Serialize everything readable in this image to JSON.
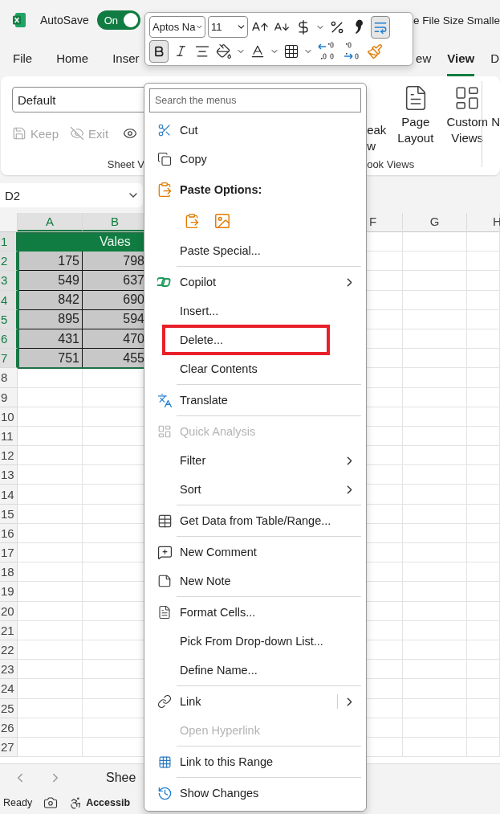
{
  "title_bar": {
    "autosave_label": "AutoSave",
    "autosave_toggle": {
      "label": "On",
      "on": true
    },
    "title": "e File Size Smalle"
  },
  "ribbon_tabs": [
    {
      "label": "File",
      "selected": false
    },
    {
      "label": "Home",
      "selected": false
    },
    {
      "label": "Inser",
      "selected": false
    },
    {
      "label": "ew",
      "selected": false
    },
    {
      "label": "View",
      "selected": true
    },
    {
      "label": "D",
      "selected": false
    }
  ],
  "ribbon": {
    "sheet_view_field": "Default",
    "sheet_view_buttons": [
      {
        "label": "Keep",
        "disabled": true
      },
      {
        "label": "Exit",
        "disabled": true
      }
    ],
    "sheet_view_group": "Sheet V",
    "workbook_fragment": [
      "eak",
      "w"
    ],
    "workbook_buttons": [
      {
        "lines": [
          "Page",
          "Layout"
        ]
      },
      {
        "lines": [
          "Custom",
          "Views"
        ]
      }
    ],
    "workbook_group": "ook Views",
    "next_fragment": "N"
  },
  "name_box": "D2",
  "columns_left": [
    {
      "label": "A",
      "selected": true
    },
    {
      "label": "B",
      "selected": true
    }
  ],
  "columns_right": [
    {
      "label": "F",
      "selected": false
    },
    {
      "label": "G",
      "selected": false
    },
    {
      "label": "H",
      "selected": false
    }
  ],
  "rows": [
    {
      "header": "1",
      "selected": true,
      "kind": "title",
      "title": "Vales"
    },
    {
      "header": "2",
      "selected": true,
      "kind": "values",
      "cells": [
        "175",
        "798"
      ]
    },
    {
      "header": "3",
      "selected": true,
      "kind": "values",
      "cells": [
        "549",
        "637"
      ]
    },
    {
      "header": "4",
      "selected": true,
      "kind": "values",
      "cells": [
        "842",
        "690"
      ]
    },
    {
      "header": "5",
      "selected": true,
      "kind": "values",
      "cells": [
        "895",
        "594"
      ]
    },
    {
      "header": "6",
      "selected": true,
      "kind": "values",
      "cells": [
        "431",
        "470"
      ]
    },
    {
      "header": "7",
      "selected": true,
      "kind": "values",
      "cells": [
        "751",
        "455"
      ]
    },
    {
      "header": "8",
      "selected": false,
      "kind": "empty"
    },
    {
      "header": "9",
      "selected": false,
      "kind": "empty"
    },
    {
      "header": "10",
      "selected": false,
      "kind": "empty"
    },
    {
      "header": "11",
      "selected": false,
      "kind": "empty"
    },
    {
      "header": "12",
      "selected": false,
      "kind": "empty"
    },
    {
      "header": "13",
      "selected": false,
      "kind": "empty"
    },
    {
      "header": "14",
      "selected": false,
      "kind": "empty"
    },
    {
      "header": "15",
      "selected": false,
      "kind": "empty"
    },
    {
      "header": "16",
      "selected": false,
      "kind": "empty"
    },
    {
      "header": "17",
      "selected": false,
      "kind": "empty"
    },
    {
      "header": "18",
      "selected": false,
      "kind": "empty"
    },
    {
      "header": "19",
      "selected": false,
      "kind": "empty"
    },
    {
      "header": "20",
      "selected": false,
      "kind": "empty"
    },
    {
      "header": "21",
      "selected": false,
      "kind": "empty"
    },
    {
      "header": "22",
      "selected": false,
      "kind": "empty"
    },
    {
      "header": "23",
      "selected": false,
      "kind": "empty"
    },
    {
      "header": "24",
      "selected": false,
      "kind": "empty"
    },
    {
      "header": "25",
      "selected": false,
      "kind": "empty"
    },
    {
      "header": "26",
      "selected": false,
      "kind": "empty"
    },
    {
      "header": "27",
      "selected": false,
      "kind": "empty"
    }
  ],
  "sheet_tabs": {
    "tab": "Shee"
  },
  "status_bar": {
    "status": "Ready",
    "accessibility": "Accessib"
  },
  "mini_toolbar": {
    "rows": [
      [
        {
          "kind": "select",
          "value": "Aptos Na"
        },
        {
          "kind": "select",
          "value": "11"
        },
        {
          "kind": "button",
          "selected": false
        },
        {
          "kind": "button",
          "selected": false
        },
        {
          "kind": "button",
          "selected": false
        },
        {
          "kind": "dropdown"
        },
        {
          "kind": "button",
          "selected": false
        },
        {
          "kind": "button",
          "selected": false
        },
        {
          "kind": "button",
          "selected": true
        }
      ],
      [
        {
          "kind": "button",
          "selected": true
        },
        {
          "kind": "button",
          "selected": false
        },
        {
          "kind": "button",
          "selected": false
        },
        {
          "kind": "button",
          "selected": false
        },
        {
          "kind": "dropdown"
        },
        {
          "kind": "button",
          "selected": false
        },
        {
          "kind": "dropdown"
        },
        {
          "kind": "button",
          "selected": false
        },
        {
          "kind": "dropdown"
        },
        {
          "kind": "button",
          "selected": false
        },
        {
          "kind": "button",
          "selected": false
        },
        {
          "kind": "button",
          "selected": false
        }
      ]
    ]
  },
  "context_menu": {
    "search_placeholder": "Search the menus",
    "items": [
      {
        "kind": "item",
        "label": "Cut",
        "disabled": false,
        "highlighted": false
      },
      {
        "kind": "item",
        "label": "Copy",
        "disabled": false,
        "highlighted": false
      },
      {
        "kind": "header",
        "label": "Paste Options:"
      },
      {
        "kind": "paste_options"
      },
      {
        "kind": "item",
        "label": "Paste Special...",
        "disabled": false,
        "highlighted": false
      },
      {
        "kind": "separator"
      },
      {
        "kind": "submenu",
        "label": "Copilot",
        "disabled": false,
        "highlighted": false
      },
      {
        "kind": "item",
        "label": "Insert...",
        "disabled": false,
        "highlighted": false
      },
      {
        "kind": "item",
        "label": "Delete...",
        "disabled": false,
        "highlighted": true
      },
      {
        "kind": "item",
        "label": "Clear Contents",
        "disabled": false,
        "highlighted": false
      },
      {
        "kind": "separator"
      },
      {
        "kind": "item",
        "label": "Translate",
        "disabled": false,
        "highlighted": false
      },
      {
        "kind": "separator"
      },
      {
        "kind": "item",
        "label": "Quick Analysis",
        "disabled": true,
        "highlighted": false
      },
      {
        "kind": "submenu",
        "label": "Filter",
        "disabled": false,
        "highlighted": false
      },
      {
        "kind": "submenu",
        "label": "Sort",
        "disabled": false,
        "highlighted": false
      },
      {
        "kind": "separator"
      },
      {
        "kind": "item",
        "label": "Get Data from Table/Range...",
        "disabled": false,
        "highlighted": false
      },
      {
        "kind": "separator"
      },
      {
        "kind": "item",
        "label": "New Comment",
        "disabled": false,
        "highlighted": false
      },
      {
        "kind": "item",
        "label": "New Note",
        "disabled": false,
        "highlighted": false
      },
      {
        "kind": "separator"
      },
      {
        "kind": "item",
        "label": "Format Cells...",
        "disabled": false,
        "highlighted": false
      },
      {
        "kind": "item",
        "label": "Pick From Drop-down List...",
        "disabled": false,
        "highlighted": false
      },
      {
        "kind": "item",
        "label": "Define Name...",
        "disabled": false,
        "highlighted": false
      },
      {
        "kind": "separator"
      },
      {
        "kind": "split",
        "label": "Link",
        "disabled": false,
        "highlighted": false
      },
      {
        "kind": "item",
        "label": "Open Hyperlink",
        "disabled": true,
        "highlighted": false
      },
      {
        "kind": "separator"
      },
      {
        "kind": "item",
        "label": "Link to this Range",
        "disabled": false,
        "highlighted": false
      },
      {
        "kind": "separator"
      },
      {
        "kind": "item",
        "label": "Show Changes",
        "disabled": false,
        "highlighted": false
      }
    ]
  }
}
